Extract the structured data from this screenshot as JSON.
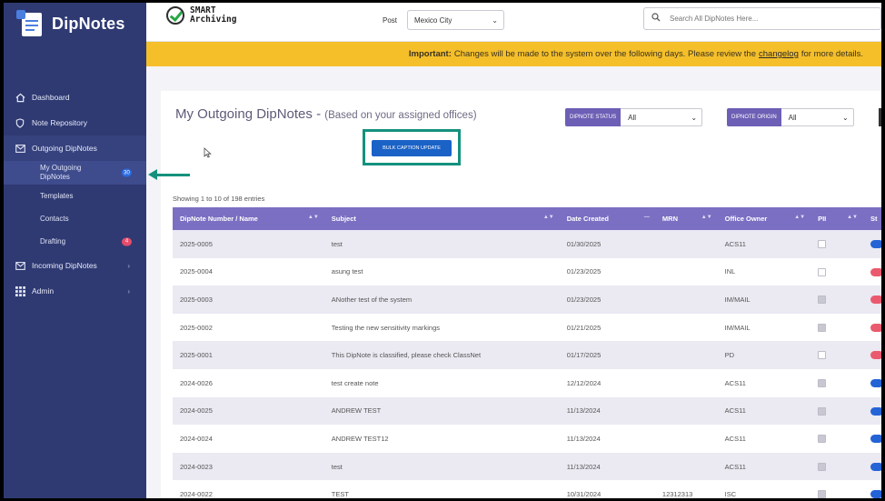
{
  "brand": {
    "name": "DipNotes"
  },
  "sidebar": {
    "items": [
      {
        "label": "Dashboard",
        "icon": "home-icon"
      },
      {
        "label": "Note Repository",
        "icon": "repository-icon"
      },
      {
        "label": "Outgoing DipNotes",
        "icon": "mail-icon"
      },
      {
        "label": "Incoming DipNotes",
        "icon": "mail-in-icon"
      },
      {
        "label": "Admin",
        "icon": "grid-icon"
      }
    ],
    "sub_items": [
      {
        "label": "My Outgoing DipNotes",
        "badge": "30"
      },
      {
        "label": "Templates"
      },
      {
        "label": "Contacts"
      },
      {
        "label": "Drafting",
        "badge": "4"
      }
    ]
  },
  "header": {
    "logo_line1": "SMART",
    "logo_line2": "Archiving",
    "post_label": "Post",
    "post_value": "Mexico City",
    "search_placeholder": "Search All DipNotes Here..."
  },
  "banner": {
    "strong": "Important:",
    "text": "Changes will be made to the system over the following days. Please review the",
    "link": "changelog",
    "tail": "for more details."
  },
  "main": {
    "title": "My Outgoing DipNotes -",
    "subtitle": "(Based on your assigned offices)",
    "status_filter": {
      "label": "DIPNOTE STATUS",
      "value": "All"
    },
    "origin_filter": {
      "label": "DIPNOTE ORIGIN",
      "value": "All"
    },
    "bulk_button": "BULK CAPTION UPDATE",
    "entries": "Showing 1 to 10 of 198 entries"
  },
  "table": {
    "headers": [
      "DipNote Number / Name",
      "Subject",
      "Date Created",
      "MRN",
      "Office Owner",
      "PII",
      "St"
    ],
    "rows": [
      {
        "num": "2025-0005",
        "subject": "test",
        "date": "01/30/2025",
        "mrn": "",
        "office": "ACS11",
        "pii": false,
        "status": "blue"
      },
      {
        "num": "2025-0004",
        "subject": "asung test",
        "date": "01/23/2025",
        "mrn": "",
        "office": "INL",
        "pii": false,
        "status": "red"
      },
      {
        "num": "2025-0003",
        "subject": "ANother test of the system",
        "date": "01/23/2025",
        "mrn": "",
        "office": "IM/MAIL",
        "pii": true,
        "status": "red"
      },
      {
        "num": "2025-0002",
        "subject": "Testing the new sensitivity markings",
        "date": "01/21/2025",
        "mrn": "",
        "office": "IM/MAIL",
        "pii": true,
        "status": "red"
      },
      {
        "num": "2025-0001",
        "subject": "This DipNote is classified, please check ClassNet",
        "date": "01/17/2025",
        "mrn": "",
        "office": "PD",
        "pii": false,
        "status": "red"
      },
      {
        "num": "2024-0026",
        "subject": "test create note",
        "date": "12/12/2024",
        "mrn": "",
        "office": "ACS11",
        "pii": true,
        "status": "blue"
      },
      {
        "num": "2024-0025",
        "subject": "ANDREW TEST",
        "date": "11/13/2024",
        "mrn": "",
        "office": "ACS11",
        "pii": true,
        "status": "blue"
      },
      {
        "num": "2024-0024",
        "subject": "ANDREW TEST12",
        "date": "11/13/2024",
        "mrn": "",
        "office": "ACS11",
        "pii": true,
        "status": "blue"
      },
      {
        "num": "2024-0023",
        "subject": "test",
        "date": "11/13/2024",
        "mrn": "",
        "office": "ACS11",
        "pii": true,
        "status": "blue"
      },
      {
        "num": "2024-0022",
        "subject": "TEST",
        "date": "10/31/2024",
        "mrn": "12312313",
        "office": "ISC",
        "pii": true,
        "status": "blue"
      }
    ]
  },
  "colors": {
    "sidebar": "#2f3a73",
    "banner": "#f5bf2a",
    "header_row": "#7a6fc2",
    "highlight": "#14917e",
    "button": "#1b62c7"
  }
}
